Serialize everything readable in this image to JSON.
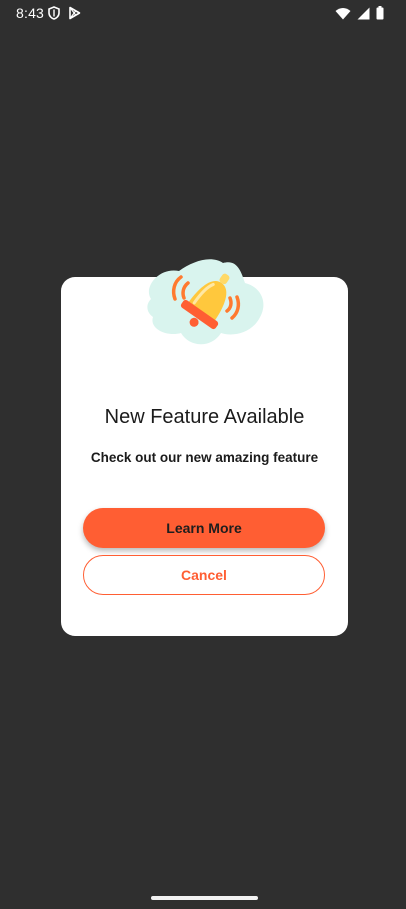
{
  "status_bar": {
    "time": "8:43",
    "left_icons": [
      "shield-icon",
      "play-store-icon"
    ],
    "right_icons": [
      "wifi-icon",
      "signal-icon",
      "battery-icon"
    ]
  },
  "dialog": {
    "illustration": "bell-notification-icon",
    "title": "New Feature Available",
    "message": "Check out our new amazing feature",
    "primary_button_label": "Learn More",
    "secondary_button_label": "Cancel"
  },
  "colors": {
    "background": "#2f2f2f",
    "accent": "#ff5e33",
    "card": "#ffffff",
    "blob": "#d9f4ee",
    "bell": "#ffc83d"
  }
}
